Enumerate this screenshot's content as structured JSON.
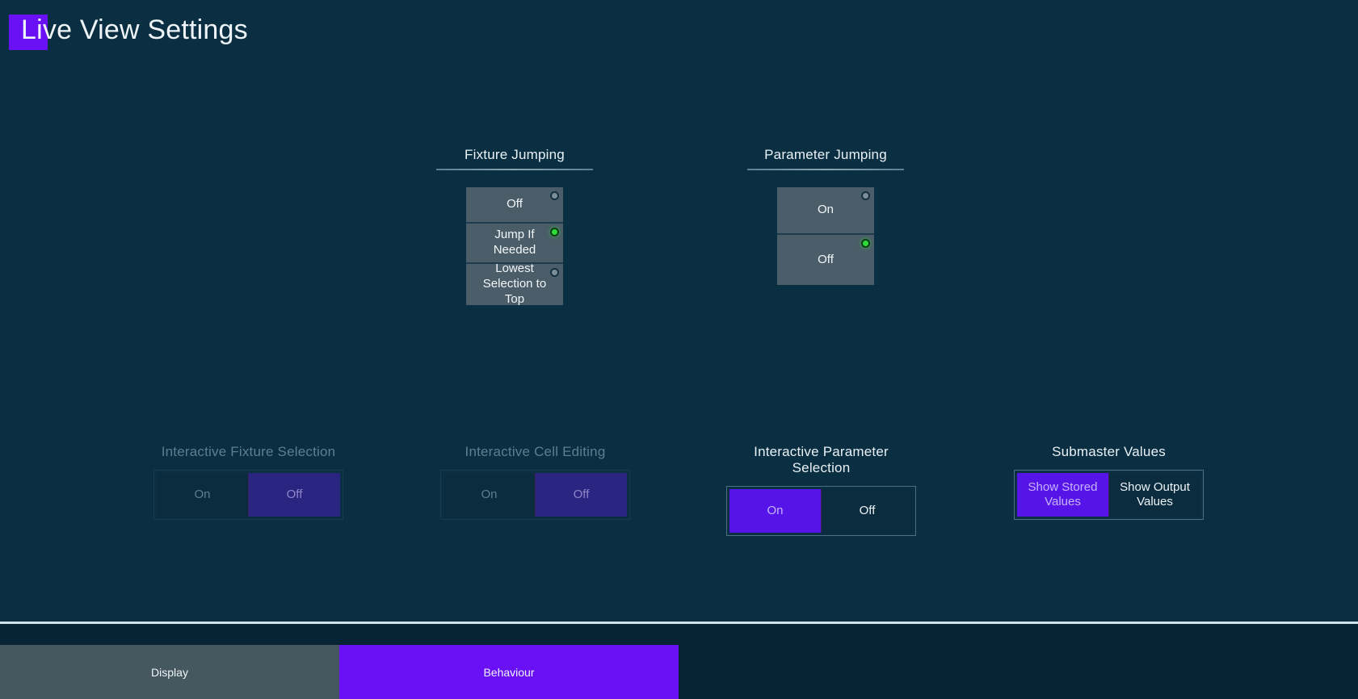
{
  "window": {
    "title": "Live View Settings",
    "accent_color": "#6a10f5",
    "background_color": "#0a2e42"
  },
  "stack_groups": [
    {
      "name": "fixture-jumping",
      "title": "Fixture Jumping",
      "options": [
        {
          "label": "Off",
          "active": false
        },
        {
          "label": "Jump If Needed",
          "active": true
        },
        {
          "label": "Lowest Selection to Top",
          "active": false
        }
      ]
    },
    {
      "name": "parameter-jumping",
      "title": "Parameter Jumping",
      "options": [
        {
          "label": "On",
          "active": false
        },
        {
          "label": "Off",
          "active": true
        }
      ]
    }
  ],
  "toggle_groups": [
    {
      "name": "interactive-fixture-selection",
      "title": "Interactive Fixture Selection",
      "disabled": true,
      "options": [
        {
          "label": "On",
          "active": false
        },
        {
          "label": "Off",
          "active": true
        }
      ]
    },
    {
      "name": "interactive-cell-editing",
      "title": "Interactive Cell Editing",
      "disabled": true,
      "options": [
        {
          "label": "On",
          "active": false
        },
        {
          "label": "Off",
          "active": true
        }
      ]
    },
    {
      "name": "interactive-parameter-selection",
      "title": "Interactive Parameter Selection",
      "disabled": false,
      "options": [
        {
          "label": "On",
          "active": true
        },
        {
          "label": "Off",
          "active": false
        }
      ]
    },
    {
      "name": "submaster-values",
      "title": "Submaster Values",
      "disabled": false,
      "options": [
        {
          "label": "Show Stored Values",
          "active": true
        },
        {
          "label": "Show Output Values",
          "active": false
        }
      ]
    }
  ],
  "tabs": [
    {
      "label": "Display",
      "active": false
    },
    {
      "label": "Behaviour",
      "active": true
    }
  ],
  "colors": {
    "led_on": "#2ddc34",
    "led_off": "#7d8e97",
    "segment_active": "#5714e8",
    "segment_active_disabled": "#2a2580",
    "stack_button": "#4b5d68",
    "tab_active": "#6a10f5",
    "tab_inactive": "#46585f"
  }
}
